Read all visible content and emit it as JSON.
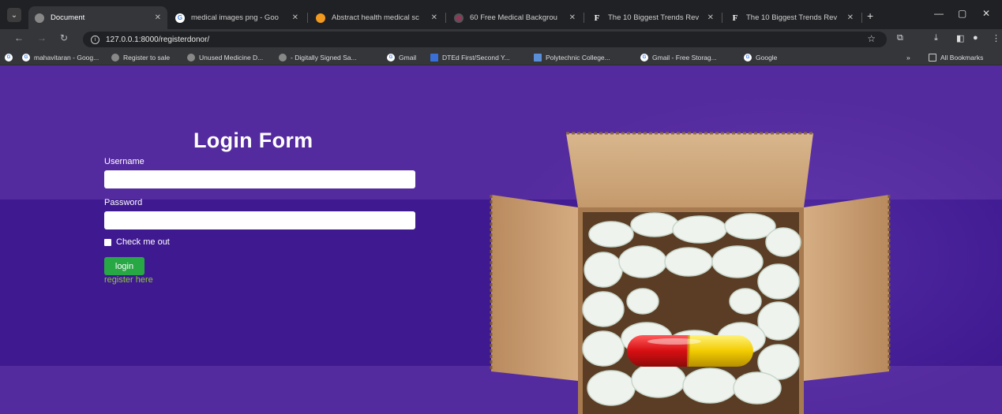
{
  "browser": {
    "tabs": [
      {
        "title": "Document",
        "active": true
      },
      {
        "title": "medical images png - Goo"
      },
      {
        "title": "Abstract health medical sc"
      },
      {
        "title": "60 Free Medical Backgrou"
      },
      {
        "title": "The 10 Biggest Trends Rev"
      },
      {
        "title": "The 10 Biggest Trends Rev"
      }
    ],
    "url": "127.0.0.1:8000/registerdonor/",
    "bookmarks": [
      "mahavitaran - Goog...",
      "Register to sale",
      "Unused Medicine D...",
      "- Digitally Signed Sa...",
      "Gmail",
      "DTEd First/Second Y...",
      "Polytechnic College...",
      "Gmail - Free Storag...",
      "Google"
    ],
    "overflow": "»",
    "all_bookmarks": "All Bookmarks"
  },
  "form": {
    "title": "Login Form",
    "username_label": "Username",
    "username_value": "",
    "password_label": "Password",
    "password_value": "",
    "checkbox_label": "Check me out",
    "login_label": "login",
    "register_link": "register here"
  }
}
